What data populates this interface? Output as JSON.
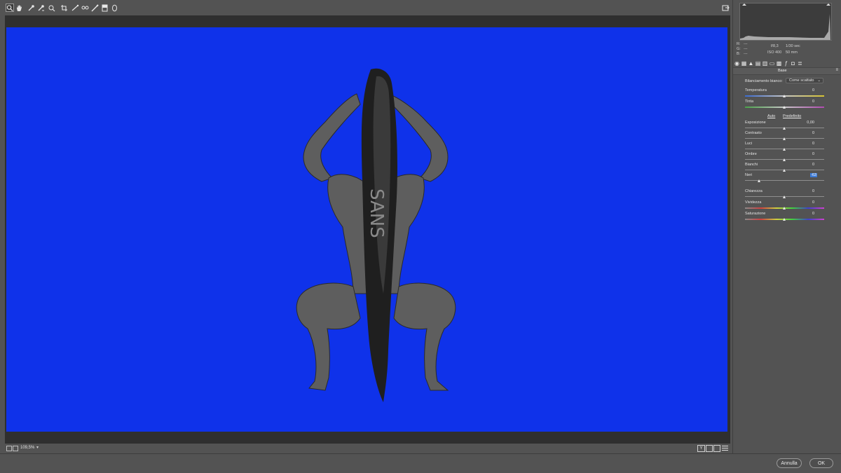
{
  "toolbar": {
    "tools": [
      {
        "icon": "zoom-icon"
      },
      {
        "icon": "hand-icon"
      },
      {
        "icon": "white-balance-icon"
      },
      {
        "icon": "color-sampler-icon"
      },
      {
        "icon": "targeted-adjust-icon"
      },
      {
        "icon": "crop-icon"
      },
      {
        "icon": "straighten-icon"
      },
      {
        "icon": "spot-removal-icon"
      },
      {
        "icon": "red-eye-icon"
      },
      {
        "icon": "adjustment-brush-icon"
      },
      {
        "icon": "graduated-filter-icon"
      },
      {
        "icon": "radial-filter-icon"
      }
    ]
  },
  "status": {
    "zoom": "109,5%"
  },
  "buttons": {
    "cancel": "Annulla",
    "ok": "OK"
  },
  "info": {
    "r_label": "R:",
    "g_label": "G:",
    "b_label": "B:",
    "r_value": "---",
    "g_value": "---",
    "b_value": "---",
    "aperture": "f/8,3",
    "shutter": "1/30 sec",
    "iso": "ISO 400",
    "focal": "50 mm"
  },
  "panel": {
    "section": "Base",
    "wb_label": "Bilanciamento bianco:",
    "wb_value": "Come scattato",
    "auto": "Auto",
    "default": "Predefinito",
    "sliders": [
      {
        "label": "Temperatura",
        "value": "0",
        "level": 0.5
      },
      {
        "label": "Tinta",
        "value": "0",
        "level": 0.5
      },
      {
        "label": "Esposizione",
        "value": "0,00",
        "level": 0.5
      },
      {
        "label": "Contrasto",
        "value": "0",
        "level": 0.5
      },
      {
        "label": "Luci",
        "value": "0",
        "level": 0.5
      },
      {
        "label": "Ombre",
        "value": "0",
        "level": 0.5
      },
      {
        "label": "Bianchi",
        "value": "0",
        "level": 0.5
      },
      {
        "label": "Neri",
        "value": "-63",
        "level": 0.185
      },
      {
        "label": "Chiarezza",
        "value": "0",
        "level": 0.5
      },
      {
        "label": "Vividezza",
        "value": "0",
        "level": 0.5
      },
      {
        "label": "Saturazione",
        "value": "0",
        "level": 0.5
      }
    ]
  },
  "colors": {
    "canvas_bg": "#0f32ea",
    "highlight": "#3d7bd6"
  }
}
